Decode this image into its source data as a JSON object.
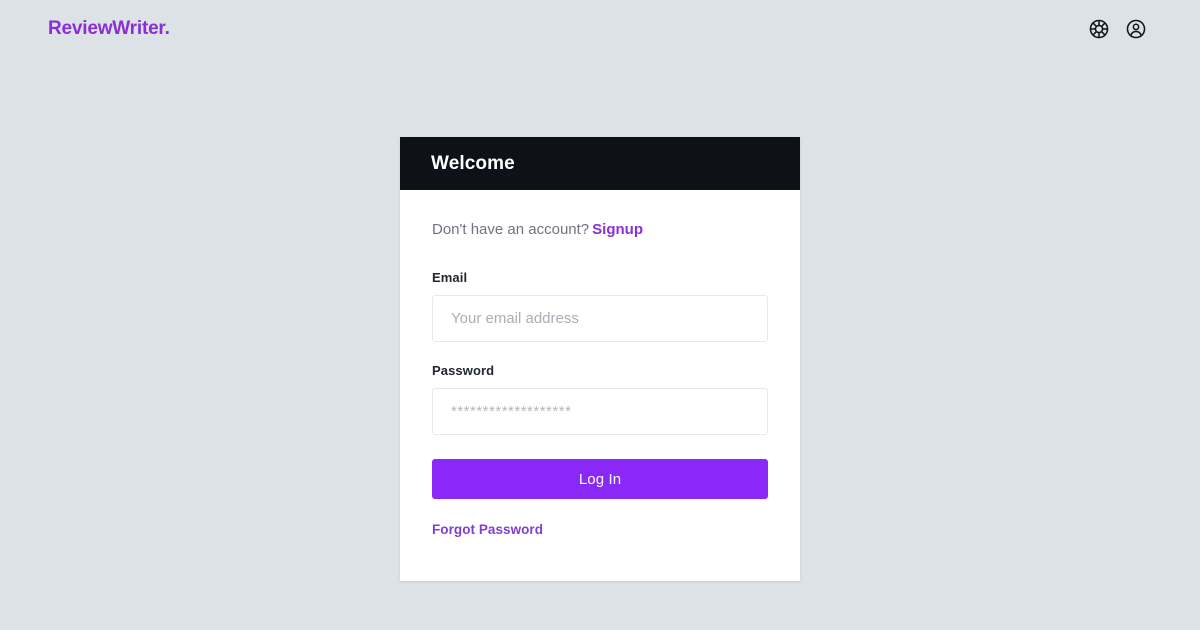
{
  "brand": {
    "name": "ReviewWriter."
  },
  "topbar": {
    "help_icon": "lifebuoy-icon",
    "account_icon": "user-circle-icon"
  },
  "card": {
    "header_title": "Welcome",
    "signup_prompt": "Don't have an account?",
    "signup_link": "Signup",
    "email": {
      "label": "Email",
      "placeholder": "Your email address",
      "value": ""
    },
    "password": {
      "label": "Password",
      "placeholder": "*******************",
      "value": ""
    },
    "submit_label": "Log In",
    "forgot_label": "Forgot Password"
  },
  "colors": {
    "page_background": "#dde2e6",
    "brand_purple": "#8a2fd6",
    "accent_purple": "#8a29f7",
    "header_dark": "#0e1218",
    "card_white": "#ffffff"
  }
}
